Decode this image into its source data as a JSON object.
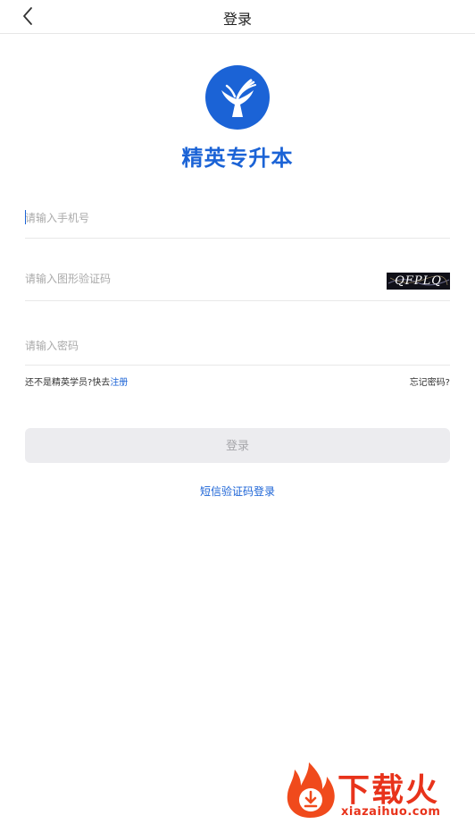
{
  "nav": {
    "title": "登录",
    "back_icon": "chevron-left-icon"
  },
  "brand": {
    "name": "精英专升本",
    "logo_icon": "book-tree-logo",
    "color": "#1b63d6"
  },
  "form": {
    "phone_placeholder": "请输入手机号",
    "captcha_placeholder": "请输入图形验证码",
    "captcha_text": "QFPLQ",
    "password_placeholder": "请输入密码"
  },
  "links": {
    "not_member": "还不是精英学员?快去",
    "register": "注册",
    "forgot": "忘记密码?"
  },
  "login_button": {
    "label": "登录"
  },
  "sms_login": {
    "label": "短信验证码登录"
  },
  "watermark": {
    "title": "下载火",
    "url": "xiazaihuo.com"
  }
}
